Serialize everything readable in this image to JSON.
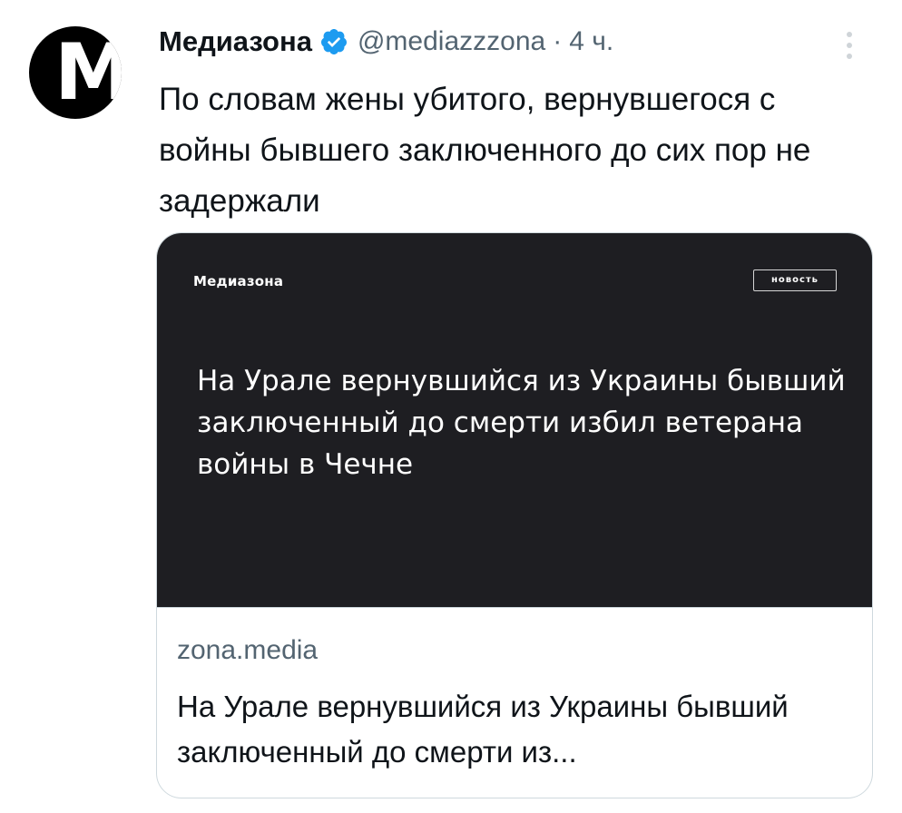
{
  "tweet": {
    "avatar_letter": "M",
    "author_name": "Медиазона",
    "handle": "@mediazzzona",
    "separator": "·",
    "timestamp": "4 ч.",
    "text": "По словам жены убитого, вернувшегося с войны бывшего заключенного до сих пор не задержали",
    "verified": true,
    "more_icon": "more-vertical-icon"
  },
  "card": {
    "image": {
      "logo_text": "Медиазона",
      "badge": "новость",
      "headline": "На Урале вернувшийся из Украины бывший заключенный до смерти избил ветерана войны в Чечне"
    },
    "domain": "zona.media",
    "title": "На Урале вернувшийся из Украины бывший заключенный до смерти из..."
  },
  "colors": {
    "verified_blue": "#1d9bf0",
    "text_primary": "#0f1419",
    "text_secondary": "#536471",
    "card_image_bg": "#1e1e22",
    "border": "#cfd9de"
  }
}
